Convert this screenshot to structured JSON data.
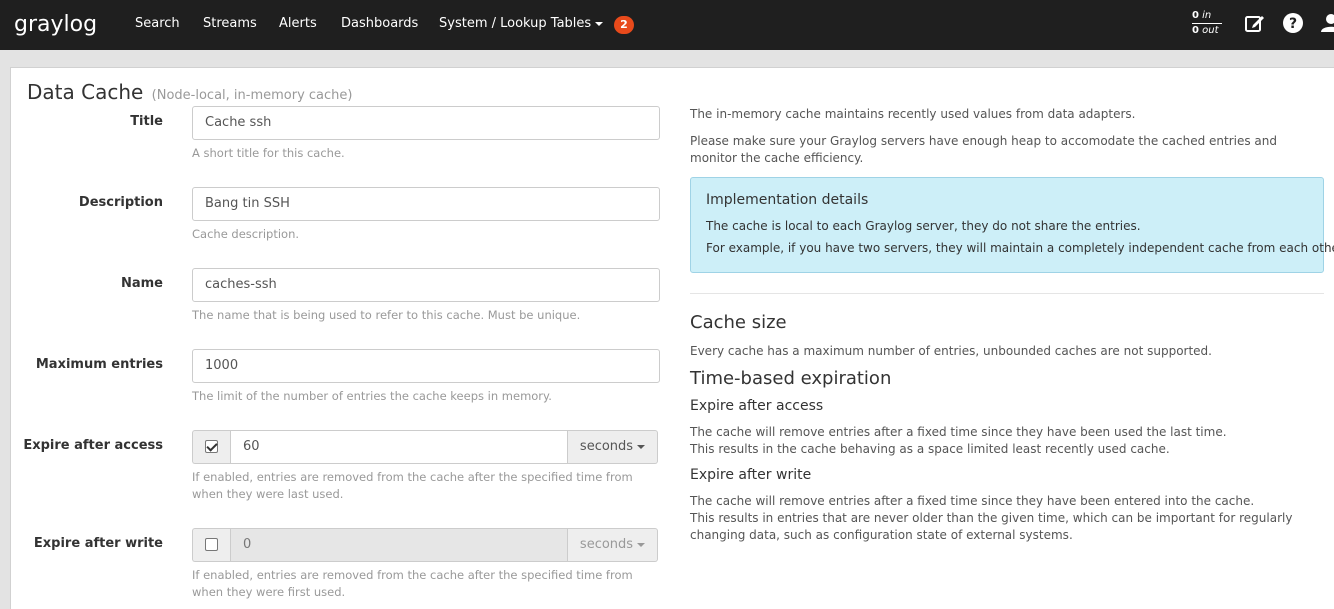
{
  "navbar": {
    "brand": "graylog",
    "links": [
      "Search",
      "Streams",
      "Alerts",
      "Dashboards"
    ],
    "system_label": "System / Lookup Tables",
    "notification_count": "2",
    "throughput_in_value": "0",
    "throughput_in_label": "in",
    "throughput_out_value": "0",
    "throughput_out_label": "out"
  },
  "page": {
    "title": "Data Cache",
    "subtitle": "(Node-local, in-memory cache)"
  },
  "form": {
    "title_label": "Title",
    "title_value": "Cache ssh",
    "title_help": "A short title for this cache.",
    "description_label": "Description",
    "description_value": "Bang tin SSH",
    "description_help": "Cache description.",
    "name_label": "Name",
    "name_value": "caches-ssh",
    "name_help": "The name that is being used to refer to this cache. Must be unique.",
    "max_entries_label": "Maximum entries",
    "max_entries_value": "1000",
    "max_entries_help": "The limit of the number of entries the cache keeps in memory.",
    "expire_access_label": "Expire after access",
    "expire_access_value": "60",
    "expire_access_unit": "seconds",
    "expire_access_help": "If enabled, entries are removed from the cache after the specified time from when they were last used.",
    "expire_write_label": "Expire after write",
    "expire_write_value": "0",
    "expire_write_unit": "seconds",
    "expire_write_help": "If enabled, entries are removed from the cache after the specified time from when they were first used."
  },
  "help_panel": {
    "intro_1": "The in-memory cache maintains recently used values from data adapters.",
    "intro_2": "Please make sure your Graylog servers have enough heap to accomodate the cached entries and monitor the cache efficiency.",
    "impl_title": "Implementation details",
    "impl_line_1": "The cache is local to each Graylog server, they do not share the entries.",
    "impl_line_2": "For example, if you have two servers, they will maintain a completely independent cache from each other.",
    "cache_size_title": "Cache size",
    "cache_size_text": "Every cache has a maximum number of entries, unbounded caches are not supported.",
    "time_exp_title": "Time-based expiration",
    "access_title": "Expire after access",
    "access_line_1": "The cache will remove entries after a fixed time since they have been used the last time.",
    "access_line_2": "This results in the cache behaving as a space limited least recently used cache.",
    "write_title": "Expire after write",
    "write_line_1": "The cache will remove entries after a fixed time since they have been entered into the cache.",
    "write_line_2": "This results in entries that are never older than the given time, which can be important for regularly changing data, such as configuration state of external systems."
  },
  "colors": {
    "navbar_bg": "#1f1f1f",
    "brand_red": "#e84a1b",
    "info_bg": "#cdeff8"
  }
}
